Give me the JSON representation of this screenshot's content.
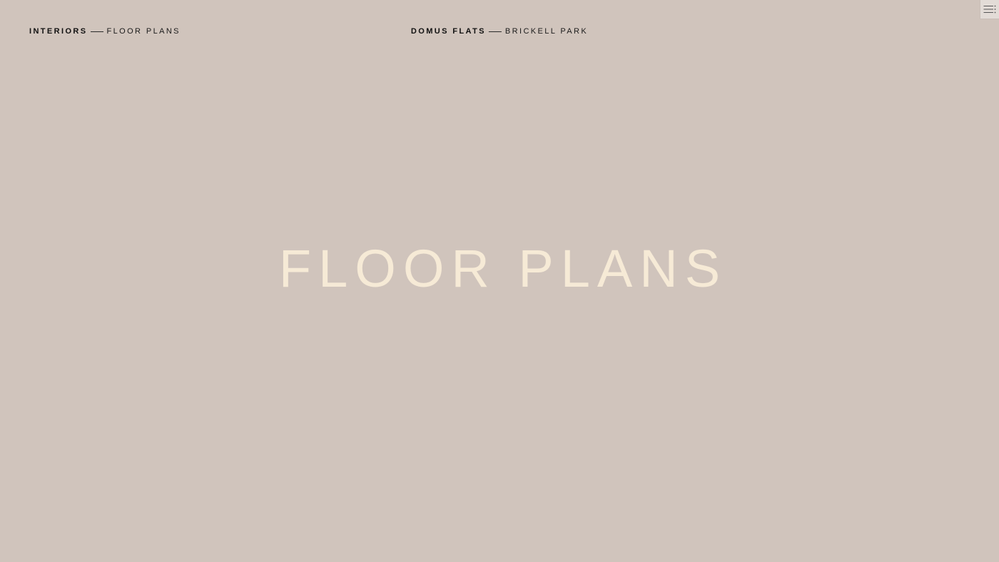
{
  "header": {
    "section": "INTERIORS",
    "page": "FLOOR PLANS",
    "property": "DOMUS FLATS",
    "location": "BRICKELL PARK"
  },
  "hero": {
    "title": "FLOOR PLANS"
  },
  "menu": {
    "icon": "menu-icon"
  },
  "colors": {
    "background": "#d0c4bc",
    "hero_text": "#f6ead6",
    "nav_text": "#111111"
  }
}
